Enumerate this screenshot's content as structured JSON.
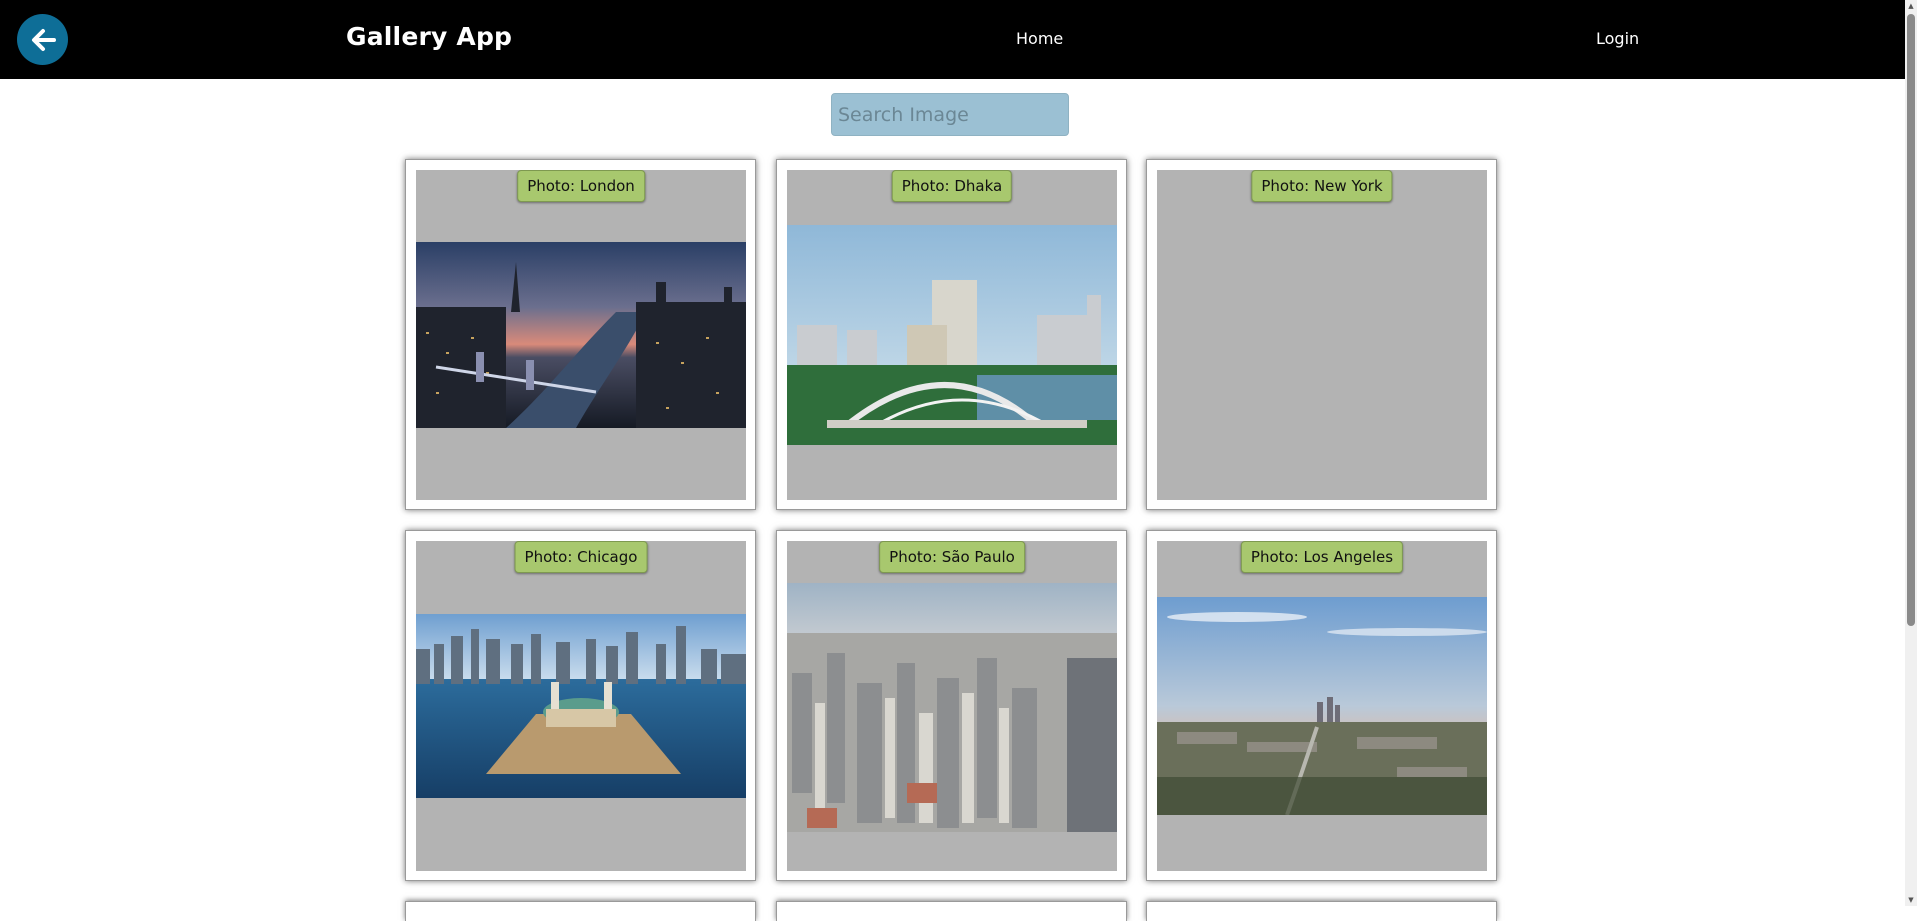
{
  "navbar": {
    "back_icon": "arrow-left-icon",
    "brand": "Gallery App",
    "links": [
      "Home",
      "Login"
    ]
  },
  "search": {
    "placeholder": "Search Image",
    "value": ""
  },
  "gallery": {
    "cards": [
      {
        "caption": "Photo: London"
      },
      {
        "caption": "Photo: Dhaka"
      },
      {
        "caption": "Photo: New York"
      },
      {
        "caption": "Photo: Chicago"
      },
      {
        "caption": "Photo: São Paulo"
      },
      {
        "caption": "Photo: Los Angeles"
      }
    ]
  },
  "colors": {
    "navbar_bg": "#000000",
    "back_button": "#0e6e97",
    "search_bg": "#9bc0d3",
    "caption_bg": "#a8c86e",
    "card_inner_bg": "#b3b3b3"
  }
}
